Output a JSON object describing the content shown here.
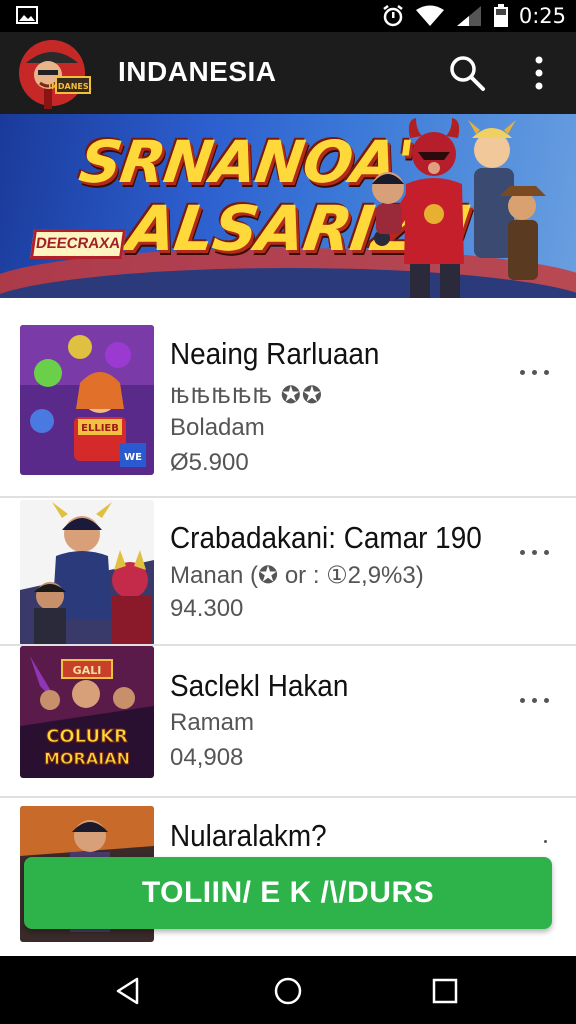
{
  "status_bar": {
    "time": "0:25",
    "icons": [
      "gallery-icon",
      "alarm-icon",
      "wifi-icon",
      "signal-icon",
      "battery-icon"
    ]
  },
  "app_bar": {
    "title": "INDANESIA",
    "logo_text": "INDANESIA",
    "icons": [
      "search-icon",
      "more-vert-icon"
    ]
  },
  "banner": {
    "headline_line1": "SRNANOA'",
    "headline_line2": "ALSARIZN",
    "tag": "DEECRAXA"
  },
  "list": {
    "items": [
      {
        "title": "Neaing Rarluaan",
        "subtitle": "ꙓꙓꙓꙓꙓ ✪✪",
        "category": "Boladam",
        "price": "Ø5.900",
        "thumb_badge": "ELLIEB",
        "thumb_corner": "WE"
      },
      {
        "title": "Crabadakani: Camar 190",
        "subtitle": "Manan (✪ or : ①2,9%3)",
        "price": "94.300"
      },
      {
        "title": "Saclekl Hakan",
        "subtitle": "Ramam",
        "price": "04,908",
        "thumb_text_line1": "COLUKR",
        "thumb_text_line2": "MORAIAN",
        "thumb_sign": "GALI"
      },
      {
        "title": "Nularalakm?"
      }
    ]
  },
  "cta": {
    "label": "TOLIIN/ E K /\\/DURS"
  },
  "nav_bar": {
    "icons": [
      "back-icon",
      "home-icon",
      "recents-icon"
    ]
  },
  "colors": {
    "accent_green": "#2db34a",
    "app_bar": "#1c1c1c",
    "headline_yellow": "#ffd83a",
    "headline_red": "#b22a1a"
  }
}
